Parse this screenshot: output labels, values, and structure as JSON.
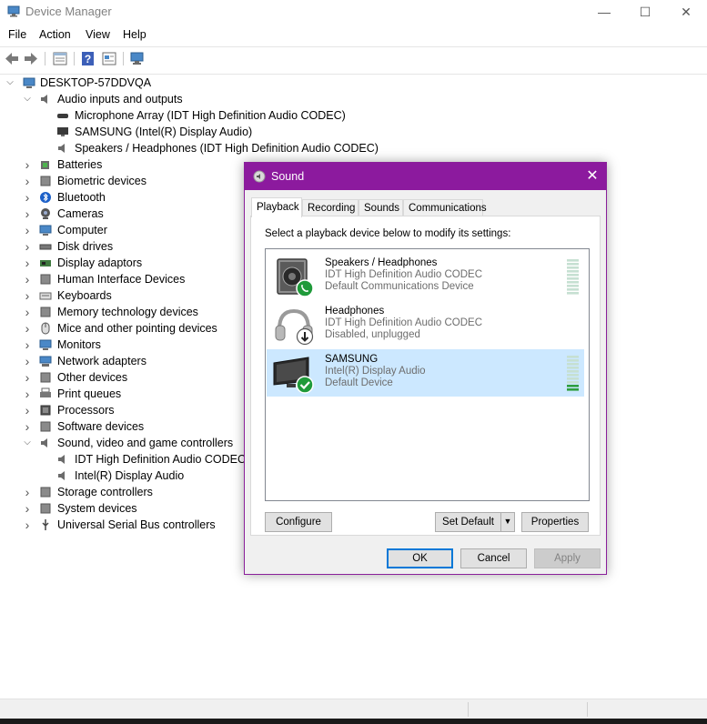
{
  "window": {
    "title": "Device Manager",
    "minimize_glyph": "—",
    "maximize_glyph": "☐",
    "close_glyph": "✕"
  },
  "menu": [
    "File",
    "Action",
    "View",
    "Help"
  ],
  "toolbar": [
    "back-icon",
    "forward-icon",
    "properties-icon",
    "help-icon",
    "update-driver-icon",
    "scan-hardware-icon"
  ],
  "tree": {
    "root": "DESKTOP-57DDVQA",
    "audio_inputs": {
      "label": "Audio inputs and outputs",
      "children": [
        "Microphone Array (IDT High Definition Audio CODEC)",
        "SAMSUNG (Intel(R) Display Audio)",
        "Speakers / Headphones (IDT High Definition Audio CODEC)"
      ]
    },
    "categories_a": [
      "Batteries",
      "Biometric devices",
      "Bluetooth",
      "Cameras",
      "Computer",
      "Disk drives",
      "Display adaptors",
      "Human Interface Devices",
      "Keyboards",
      "Memory technology devices",
      "Mice and other pointing devices",
      "Monitors",
      "Network adapters",
      "Other devices",
      "Print queues",
      "Processors",
      "Software devices"
    ],
    "sound_controllers": {
      "label": "Sound, video and game controllers",
      "children": [
        "IDT High Definition Audio CODEC",
        "Intel(R) Display Audio"
      ]
    },
    "categories_b": [
      "Storage controllers",
      "System devices",
      "Universal Serial Bus controllers"
    ]
  },
  "sound_dialog": {
    "title": "Sound",
    "tabs": [
      "Playback",
      "Recording",
      "Sounds",
      "Communications"
    ],
    "active_tab": "Playback",
    "instruction": "Select a playback device below to modify its settings:",
    "devices": [
      {
        "name": "Speakers / Headphones",
        "driver": "IDT High Definition Audio CODEC",
        "status": "Default Communications Device",
        "badge": "phone-icon",
        "level": 0
      },
      {
        "name": "Headphones",
        "driver": "IDT High Definition Audio CODEC",
        "status": "Disabled, unplugged",
        "badge": "down-arrow-icon",
        "level": 0
      },
      {
        "name": "SAMSUNG",
        "driver": "Intel(R) Display Audio",
        "status": "Default Device",
        "badge": "checkmark-icon",
        "level": 0.2,
        "selected": true
      }
    ],
    "buttons": {
      "configure": "Configure",
      "set_default": "Set Default",
      "properties": "Properties",
      "ok": "OK",
      "cancel": "Cancel",
      "apply": "Apply"
    }
  },
  "colors": {
    "accent": "#8c1a9e",
    "selection": "#cce8ff",
    "meter_on": "#2e9e3e",
    "meter_off": "#c6e0d2"
  }
}
